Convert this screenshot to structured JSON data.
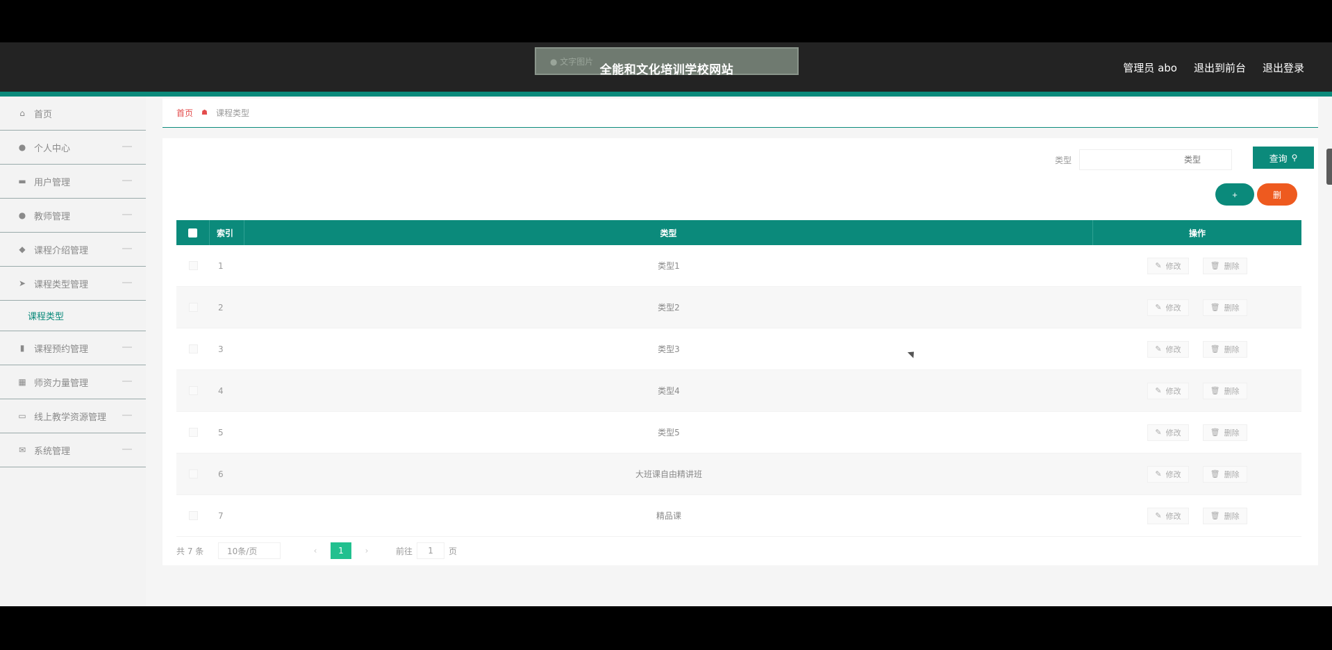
{
  "header": {
    "title": "全能和文化培训学校网站",
    "title_badge": "● 文字图片",
    "nav": [
      "管理员 abo",
      "退出到前台",
      "退出登录"
    ]
  },
  "sidebar": {
    "items": [
      {
        "label": "首页",
        "icon": "home-icon"
      },
      {
        "label": "个人中心",
        "icon": "user-icon"
      },
      {
        "label": "用户管理",
        "icon": "monitor-icon"
      },
      {
        "label": "教师管理",
        "icon": "teacher-icon"
      },
      {
        "label": "课程介绍管理",
        "icon": "pin-icon"
      },
      {
        "label": "课程类型管理",
        "icon": "send-icon"
      },
      {
        "label": "课程预约管理",
        "icon": "bar-chart-icon"
      },
      {
        "label": "师资力量管理",
        "icon": "calendar-icon"
      },
      {
        "label": "线上教学资源管理",
        "icon": "card-icon"
      },
      {
        "label": "系统管理",
        "icon": "mail-icon"
      }
    ],
    "subitem": "课程类型"
  },
  "breadcrumb": {
    "home": "首页",
    "current": "课程类型"
  },
  "search": {
    "label": "类型",
    "placeholder": "类型",
    "button": "查询"
  },
  "actions": {
    "add": "+",
    "delete": "删"
  },
  "table": {
    "columns": [
      "索引",
      "类型",
      "操作"
    ],
    "rows": [
      {
        "index": "1",
        "type": "类型1"
      },
      {
        "index": "2",
        "type": "类型2"
      },
      {
        "index": "3",
        "type": "类型3"
      },
      {
        "index": "4",
        "type": "类型4"
      },
      {
        "index": "5",
        "type": "类型5"
      },
      {
        "index": "6",
        "type": "大班课自由精讲班"
      },
      {
        "index": "7",
        "type": "精品课"
      }
    ],
    "edit_label": "修改",
    "delete_label": "删除"
  },
  "pager": {
    "total": "共 7 条",
    "size": "10条/页",
    "prev": "‹",
    "current": "1",
    "next": "›",
    "goto_label": "前往",
    "goto_value": "1",
    "goto_unit": "页"
  },
  "colors": {
    "accent": "#0b8a7b",
    "danger": "#ee5a1f",
    "header": "#232323"
  }
}
